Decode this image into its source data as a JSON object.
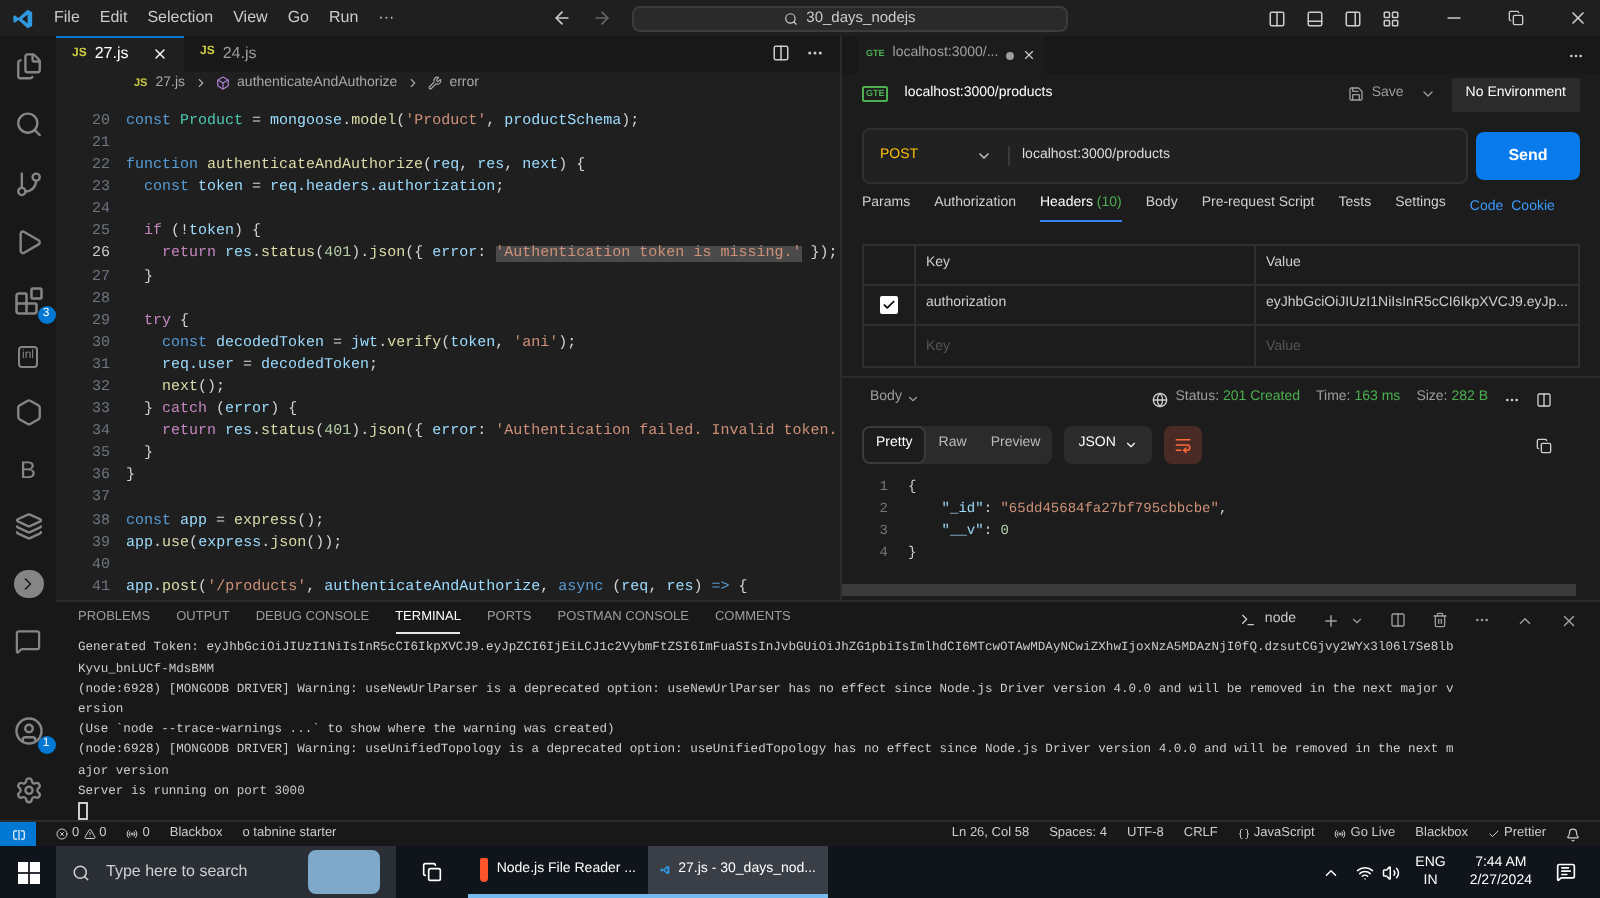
{
  "menu": [
    "File",
    "Edit",
    "Selection",
    "View",
    "Go",
    "Run",
    "···"
  ],
  "command_center": {
    "value": "30_days_nodejs"
  },
  "activity_bar": {
    "extensions_badge": "3",
    "accounts_badge": "1",
    "inline_icon": "inl",
    "letter_icon": "B"
  },
  "editor_tabs": [
    {
      "label": "27.js",
      "icon": "JS",
      "selected": true
    },
    {
      "label": "24.js",
      "icon": "JS",
      "selected": false
    }
  ],
  "breadcrumb": {
    "icon": "JS",
    "file": "27.js",
    "function": "authenticateAndAuthorize",
    "symbol": "error"
  },
  "code": [
    {
      "number": "20",
      "current": false,
      "tokens": [
        {
          "kind": "kw",
          "text": "const "
        },
        {
          "kind": "cls",
          "text": "Product"
        },
        {
          "kind": "punc",
          "text": " = "
        },
        {
          "kind": "var",
          "text": "mongoose"
        },
        {
          "kind": "punc",
          "text": "."
        },
        {
          "kind": "fn",
          "text": "model"
        },
        {
          "kind": "punc",
          "text": "("
        },
        {
          "kind": "str",
          "text": "'Product'"
        },
        {
          "kind": "punc",
          "text": ", "
        },
        {
          "kind": "var",
          "text": "productSchema"
        },
        {
          "kind": "punc",
          "text": ");"
        }
      ]
    },
    {
      "number": "21",
      "current": false
    },
    {
      "number": "22",
      "current": false,
      "tokens": [
        {
          "kind": "kw",
          "text": "function "
        },
        {
          "kind": "fn",
          "text": "authenticateAndAuthorize"
        },
        {
          "kind": "punc",
          "text": "("
        },
        {
          "kind": "var",
          "text": "req"
        },
        {
          "kind": "punc",
          "text": ", "
        },
        {
          "kind": "var",
          "text": "res"
        },
        {
          "kind": "punc",
          "text": ", "
        },
        {
          "kind": "var",
          "text": "next"
        },
        {
          "kind": "punc",
          "text": ") {"
        }
      ]
    },
    {
      "number": "23",
      "current": false,
      "tokens": [
        {
          "kind": "kw",
          "text": "  const "
        },
        {
          "kind": "var",
          "text": "token"
        },
        {
          "kind": "punc",
          "text": " = "
        },
        {
          "kind": "var",
          "text": "req.headers.authorization"
        },
        {
          "kind": "punc",
          "text": ";"
        }
      ]
    },
    {
      "number": "24",
      "current": false
    },
    {
      "number": "25",
      "current": false,
      "tokens": [
        {
          "kind": "ctrl",
          "text": "  if "
        },
        {
          "kind": "punc",
          "text": "(!"
        },
        {
          "kind": "var",
          "text": "token"
        },
        {
          "kind": "punc",
          "text": ") {"
        }
      ]
    },
    {
      "number": "26",
      "current": true,
      "tokens": [
        {
          "kind": "ctrl",
          "text": "    return "
        },
        {
          "kind": "var",
          "text": "res"
        },
        {
          "kind": "punc",
          "text": "."
        },
        {
          "kind": "fn",
          "text": "status"
        },
        {
          "kind": "punc",
          "text": "("
        },
        {
          "kind": "num",
          "text": "401"
        },
        {
          "kind": "punc",
          "text": ")."
        },
        {
          "kind": "fn",
          "text": "json"
        },
        {
          "kind": "punc",
          "text": "({ "
        },
        {
          "kind": "var",
          "text": "error"
        },
        {
          "kind": "punc",
          "text": ": "
        },
        {
          "kind": "selection",
          "text": "'Authentication token is missing.'"
        },
        {
          "kind": "punc",
          "text": " });"
        }
      ]
    },
    {
      "number": "27",
      "current": false,
      "tokens": [
        {
          "kind": "punc",
          "text": "  }"
        }
      ]
    },
    {
      "number": "28",
      "current": false
    },
    {
      "number": "29",
      "current": false,
      "tokens": [
        {
          "kind": "ctrl",
          "text": "  try "
        },
        {
          "kind": "punc",
          "text": "{"
        }
      ]
    },
    {
      "number": "30",
      "current": false,
      "tokens": [
        {
          "kind": "kw",
          "text": "    const "
        },
        {
          "kind": "var",
          "text": "decodedToken"
        },
        {
          "kind": "punc",
          "text": " = "
        },
        {
          "kind": "var",
          "text": "jwt"
        },
        {
          "kind": "punc",
          "text": "."
        },
        {
          "kind": "fn",
          "text": "verify"
        },
        {
          "kind": "punc",
          "text": "("
        },
        {
          "kind": "var",
          "text": "token"
        },
        {
          "kind": "punc",
          "text": ", "
        },
        {
          "kind": "str",
          "text": "'ani'"
        },
        {
          "kind": "punc",
          "text": ");"
        }
      ]
    },
    {
      "number": "31",
      "current": false,
      "tokens": [
        {
          "kind": "var",
          "text": "    req.user"
        },
        {
          "kind": "punc",
          "text": " = "
        },
        {
          "kind": "var",
          "text": "decodedToken"
        },
        {
          "kind": "punc",
          "text": ";"
        }
      ]
    },
    {
      "number": "32",
      "current": false,
      "tokens": [
        {
          "kind": "fn",
          "text": "    next"
        },
        {
          "kind": "punc",
          "text": "();"
        }
      ]
    },
    {
      "number": "33",
      "current": false,
      "tokens": [
        {
          "kind": "punc",
          "text": "  } "
        },
        {
          "kind": "ctrl",
          "text": "catch "
        },
        {
          "kind": "punc",
          "text": "("
        },
        {
          "kind": "var",
          "text": "error"
        },
        {
          "kind": "punc",
          "text": ") {"
        }
      ]
    },
    {
      "number": "34",
      "current": false,
      "tokens": [
        {
          "kind": "ctrl",
          "text": "    return "
        },
        {
          "kind": "var",
          "text": "res"
        },
        {
          "kind": "punc",
          "text": "."
        },
        {
          "kind": "fn",
          "text": "status"
        },
        {
          "kind": "punc",
          "text": "("
        },
        {
          "kind": "num",
          "text": "401"
        },
        {
          "kind": "punc",
          "text": ")."
        },
        {
          "kind": "fn",
          "text": "json"
        },
        {
          "kind": "punc",
          "text": "({ "
        },
        {
          "kind": "var",
          "text": "error"
        },
        {
          "kind": "punc",
          "text": ": "
        },
        {
          "kind": "str",
          "text": "'Authentication failed. Invalid token."
        }
      ]
    },
    {
      "number": "35",
      "current": false,
      "tokens": [
        {
          "kind": "punc",
          "text": "  }"
        }
      ]
    },
    {
      "number": "36",
      "current": false,
      "tokens": [
        {
          "kind": "punc",
          "text": "}"
        }
      ]
    },
    {
      "number": "37",
      "current": false
    },
    {
      "number": "38",
      "current": false,
      "tokens": [
        {
          "kind": "kw",
          "text": "const "
        },
        {
          "kind": "var",
          "text": "app"
        },
        {
          "kind": "punc",
          "text": " = "
        },
        {
          "kind": "fn",
          "text": "express"
        },
        {
          "kind": "punc",
          "text": "();"
        }
      ]
    },
    {
      "number": "39",
      "current": false,
      "tokens": [
        {
          "kind": "var",
          "text": "app"
        },
        {
          "kind": "punc",
          "text": "."
        },
        {
          "kind": "fn",
          "text": "use"
        },
        {
          "kind": "punc",
          "text": "("
        },
        {
          "kind": "var",
          "text": "express"
        },
        {
          "kind": "punc",
          "text": "."
        },
        {
          "kind": "fn",
          "text": "json"
        },
        {
          "kind": "punc",
          "text": "());"
        }
      ]
    },
    {
      "number": "40",
      "current": false
    },
    {
      "number": "41",
      "current": false,
      "tokens": [
        {
          "kind": "var",
          "text": "app"
        },
        {
          "kind": "punc",
          "text": "."
        },
        {
          "kind": "fn",
          "text": "post"
        },
        {
          "kind": "punc",
          "text": "("
        },
        {
          "kind": "str",
          "text": "'/products'"
        },
        {
          "kind": "punc",
          "text": ", "
        },
        {
          "kind": "var",
          "text": "authenticateAndAuthorize"
        },
        {
          "kind": "punc",
          "text": ", "
        },
        {
          "kind": "kw",
          "text": "async "
        },
        {
          "kind": "punc",
          "text": "("
        },
        {
          "kind": "var",
          "text": "req"
        },
        {
          "kind": "punc",
          "text": ", "
        },
        {
          "kind": "var",
          "text": "res"
        },
        {
          "kind": "punc",
          "text": ") "
        },
        {
          "kind": "kw",
          "text": "=>"
        },
        {
          "kind": "punc",
          "text": " {"
        }
      ]
    }
  ],
  "postman": {
    "tab": {
      "label": "localhost:3000/...",
      "icon": "GTE",
      "unsaved": true
    },
    "request_name": "localhost:3000/products",
    "request_icon": "GTE",
    "save": "Save",
    "environment": "No Environment",
    "method": "POST",
    "url": "localhost:3000/products",
    "send": "Send",
    "request_tabs": [
      {
        "label": "Params",
        "selected": false
      },
      {
        "label": "Authorization",
        "selected": false
      },
      {
        "label": "Headers",
        "count": "(10)",
        "selected": true
      },
      {
        "label": "Body",
        "selected": false
      },
      {
        "label": "Pre-request Script",
        "selected": false
      },
      {
        "label": "Tests",
        "selected": false
      },
      {
        "label": "Settings",
        "selected": false
      }
    ],
    "links": [
      "Code",
      "Cookie"
    ],
    "headers": {
      "columns": [
        "Key",
        "Value"
      ],
      "rows": [
        {
          "key": "authorization",
          "value": "eyJhbGciOiJIUzI1NiIsInR5cCI6IkpXVCJ9.eyJp...",
          "checked": true
        }
      ],
      "new_row": {
        "key_field": {
          "placeholder": "Key"
        },
        "value_field": {
          "placeholder": "Value"
        }
      }
    },
    "body_dropdown": "Body",
    "status": {
      "label": "Status:",
      "value": "201 Created",
      "time_label": "Time:",
      "time": "163 ms",
      "size_label": "Size:",
      "size": "282 B"
    },
    "view_modes": [
      {
        "label": "Pretty",
        "selected": true
      },
      {
        "label": "Raw",
        "selected": false
      },
      {
        "label": "Preview",
        "selected": false
      }
    ],
    "format": "JSON",
    "response": [
      {
        "number": "1",
        "tokens": [
          {
            "kind": "punc",
            "text": "{"
          }
        ]
      },
      {
        "number": "2",
        "tokens": [
          {
            "kind": "key",
            "text": "    \"_id\""
          },
          {
            "kind": "punc",
            "text": ": "
          },
          {
            "kind": "str",
            "text": "\"65dd45684fa27bf795cbbcbe\""
          },
          {
            "kind": "punc",
            "text": ","
          }
        ]
      },
      {
        "number": "3",
        "tokens": [
          {
            "kind": "key",
            "text": "    \"__v\""
          },
          {
            "kind": "punc",
            "text": ": "
          },
          {
            "kind": "num",
            "text": "0"
          }
        ]
      },
      {
        "number": "4",
        "tokens": [
          {
            "kind": "punc",
            "text": "}"
          }
        ]
      }
    ]
  },
  "panel_tabs": [
    {
      "label": "PROBLEMS",
      "selected": false
    },
    {
      "label": "OUTPUT",
      "selected": false
    },
    {
      "label": "DEBUG CONSOLE",
      "selected": false
    },
    {
      "label": "TERMINAL",
      "selected": true
    },
    {
      "label": "PORTS",
      "selected": false
    },
    {
      "label": "POSTMAN CONSOLE",
      "selected": false
    },
    {
      "label": "COMMENTS",
      "selected": false
    }
  ],
  "terminal_name": "node",
  "terminal": [
    "Generated Token: eyJhbGciOiJIUzI1NiIsInR5cCI6IkpXVCJ9.eyJpZCI6IjEiLCJ1c2VybmFtZSI6ImFuaSIsInJvbGUiOiJhZG1pbiIsImlhdCI6MTcwOTAwMDAyNCwiZXhwIjoxNzA5MDAzNjI0fQ.dzsutCGjvy2WYx3l06l7Se8lb",
    "Kyvu_bnLUCf-MdsBMM",
    "(node:6928) [MONGODB DRIVER] Warning: useNewUrlParser is a deprecated option: useNewUrlParser has no effect since Node.js Driver version 4.0.0 and will be removed in the next major v",
    "ersion",
    "(Use `node --trace-warnings ...` to show where the warning was created)",
    "(node:6928) [MONGODB DRIVER] Warning: useUnifiedTopology is a deprecated option: useUnifiedTopology has no effect since Node.js Driver version 4.0.0 and will be removed in the next m",
    "ajor version",
    "Server is running on port 3000"
  ],
  "status_bar": {
    "errors": "0",
    "warnings": "0",
    "ports": "0",
    "left": [
      "Blackbox",
      "o tabnine starter"
    ],
    "right": [
      {
        "kind": "text",
        "label": "Ln 26, Col 58"
      },
      {
        "kind": "text",
        "label": "Spaces: 4"
      },
      {
        "kind": "text",
        "label": "UTF-8"
      },
      {
        "kind": "text",
        "label": "CRLF"
      },
      {
        "kind": "braces",
        "label": "JavaScript"
      },
      {
        "kind": "live",
        "label": "Go Live"
      },
      {
        "kind": "text",
        "label": "Blackbox"
      },
      {
        "kind": "check",
        "label": "Prettier"
      }
    ]
  },
  "taskbar": {
    "search_placeholder": "Type here to search",
    "apps": [
      {
        "kind": "browser",
        "label": "Node.js File Reader ...",
        "selected": false
      },
      {
        "kind": "editor",
        "label": "27.js - 30_days_nod...",
        "selected": true
      }
    ],
    "language": "ENG",
    "region": "IN",
    "time": "7:44 AM",
    "date": "2/27/2024"
  }
}
